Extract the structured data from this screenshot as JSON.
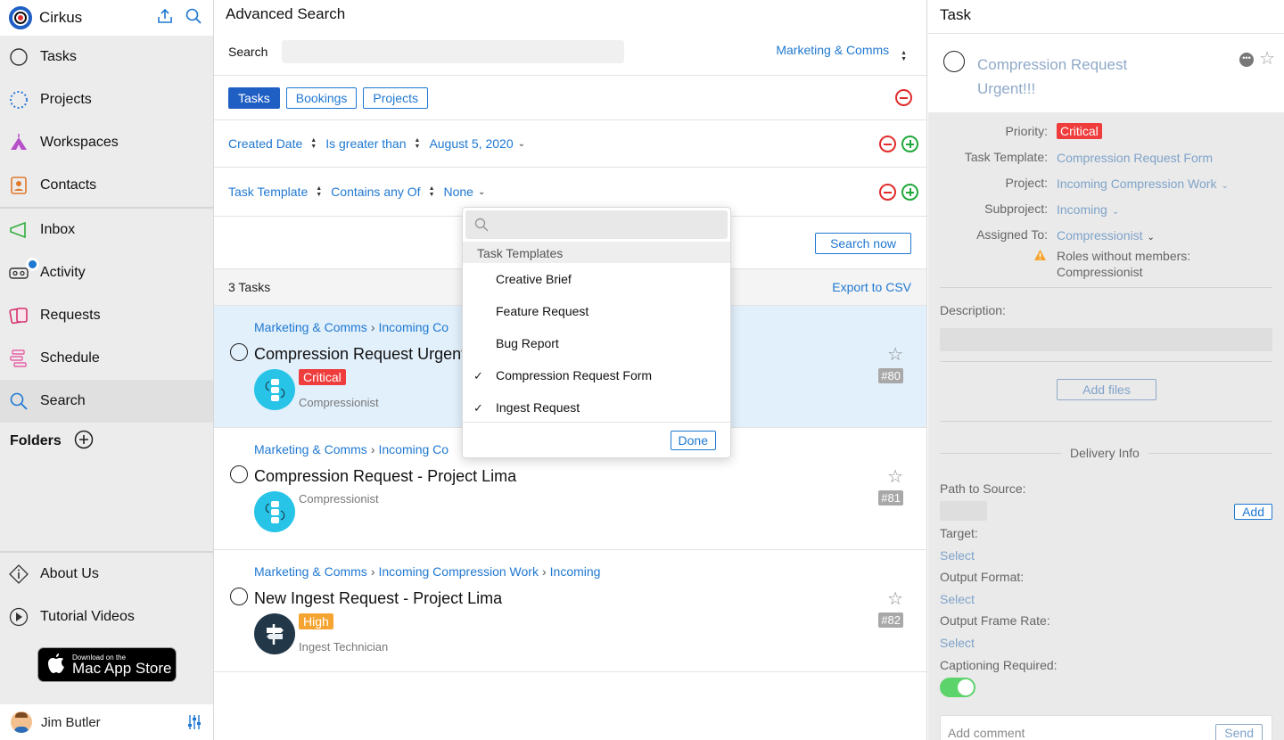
{
  "app": {
    "name": "Cirkus"
  },
  "sidebar": {
    "items": [
      {
        "label": "Tasks",
        "icon": "circle-icon"
      },
      {
        "label": "Projects",
        "icon": "dotted-circle-icon"
      },
      {
        "label": "Workspaces",
        "icon": "tent-icon"
      },
      {
        "label": "Contacts",
        "icon": "contact-card-icon"
      },
      {
        "label": "Inbox",
        "icon": "megaphone-icon"
      },
      {
        "label": "Activity",
        "icon": "voicemail-icon"
      },
      {
        "label": "Requests",
        "icon": "cards-icon"
      },
      {
        "label": "Schedule",
        "icon": "schedule-icon"
      },
      {
        "label": "Search",
        "icon": "search-icon"
      }
    ],
    "folders_label": "Folders",
    "bottom": [
      {
        "label": "About Us",
        "icon": "info-icon"
      },
      {
        "label": "Tutorial Videos",
        "icon": "play-icon"
      }
    ],
    "appstore": {
      "line1": "Download on the",
      "line2": "Mac App Store"
    },
    "user": {
      "name": "Jim Butler"
    }
  },
  "search": {
    "title": "Advanced Search",
    "search_label": "Search",
    "search_value": "",
    "workspace": "Marketing & Comms",
    "types": [
      "Tasks",
      "Bookings",
      "Projects"
    ],
    "filters": [
      {
        "field": "Created Date",
        "op": "Is greater than",
        "value": "August 5, 2020"
      },
      {
        "field": "Task Template",
        "op": "Contains any Of",
        "value": "None"
      }
    ],
    "search_now": "Search now",
    "count": "3 Tasks",
    "export": "Export to CSV"
  },
  "tasks": [
    {
      "crumbs": [
        "Marketing & Comms",
        "Incoming Co"
      ],
      "title": "Compression Request Urgent",
      "priority": "Critical",
      "role": "Compressionist",
      "number": "#80"
    },
    {
      "crumbs": [
        "Marketing & Comms",
        "Incoming Co"
      ],
      "title": "Compression Request - Project Lima",
      "priority": "",
      "role": "Compressionist",
      "number": "#81"
    },
    {
      "crumbs": [
        "Marketing & Comms",
        "Incoming Compression Work",
        "Incoming"
      ],
      "title": "New Ingest Request - Project Lima",
      "priority": "High",
      "role": "Ingest Technician",
      "number": "#82"
    }
  ],
  "dropdown": {
    "search_value": "",
    "header": "Task Templates",
    "options": [
      {
        "label": "Creative Brief",
        "checked": false
      },
      {
        "label": "Feature Request",
        "checked": false
      },
      {
        "label": "Bug Report",
        "checked": false
      },
      {
        "label": "Compression Request Form",
        "checked": true
      },
      {
        "label": "Ingest Request",
        "checked": true
      }
    ],
    "done": "Done"
  },
  "task_panel": {
    "header": "Task",
    "title": "Compression Request Urgent!!!",
    "priority_label": "Priority:",
    "priority": "Critical",
    "template_label": "Task Template:",
    "template": "Compression Request Form",
    "project_label": "Project:",
    "project": "Incoming Compression Work",
    "subproject_label": "Subproject:",
    "subproject": "Incoming",
    "assigned_label": "Assigned To:",
    "assigned": "Compressionist",
    "warning": "Roles without members:",
    "warning_role": "Compressionist",
    "description_label": "Description:",
    "add_files": "Add files",
    "delivery_info": "Delivery Info",
    "path_label": "Path to Source:",
    "add": "Add",
    "target_label": "Target:",
    "output_format_label": "Output Format:",
    "frame_rate_label": "Output Frame Rate:",
    "select": "Select",
    "captioning_label": "Captioning Required:",
    "captioning_on": true,
    "comment_placeholder": "Add comment",
    "send": "Send"
  },
  "colors": {
    "accent": "#1f78d1",
    "critical": "#ef3c3c",
    "high": "#f5a431",
    "selected_row": "#e2f0fc"
  }
}
